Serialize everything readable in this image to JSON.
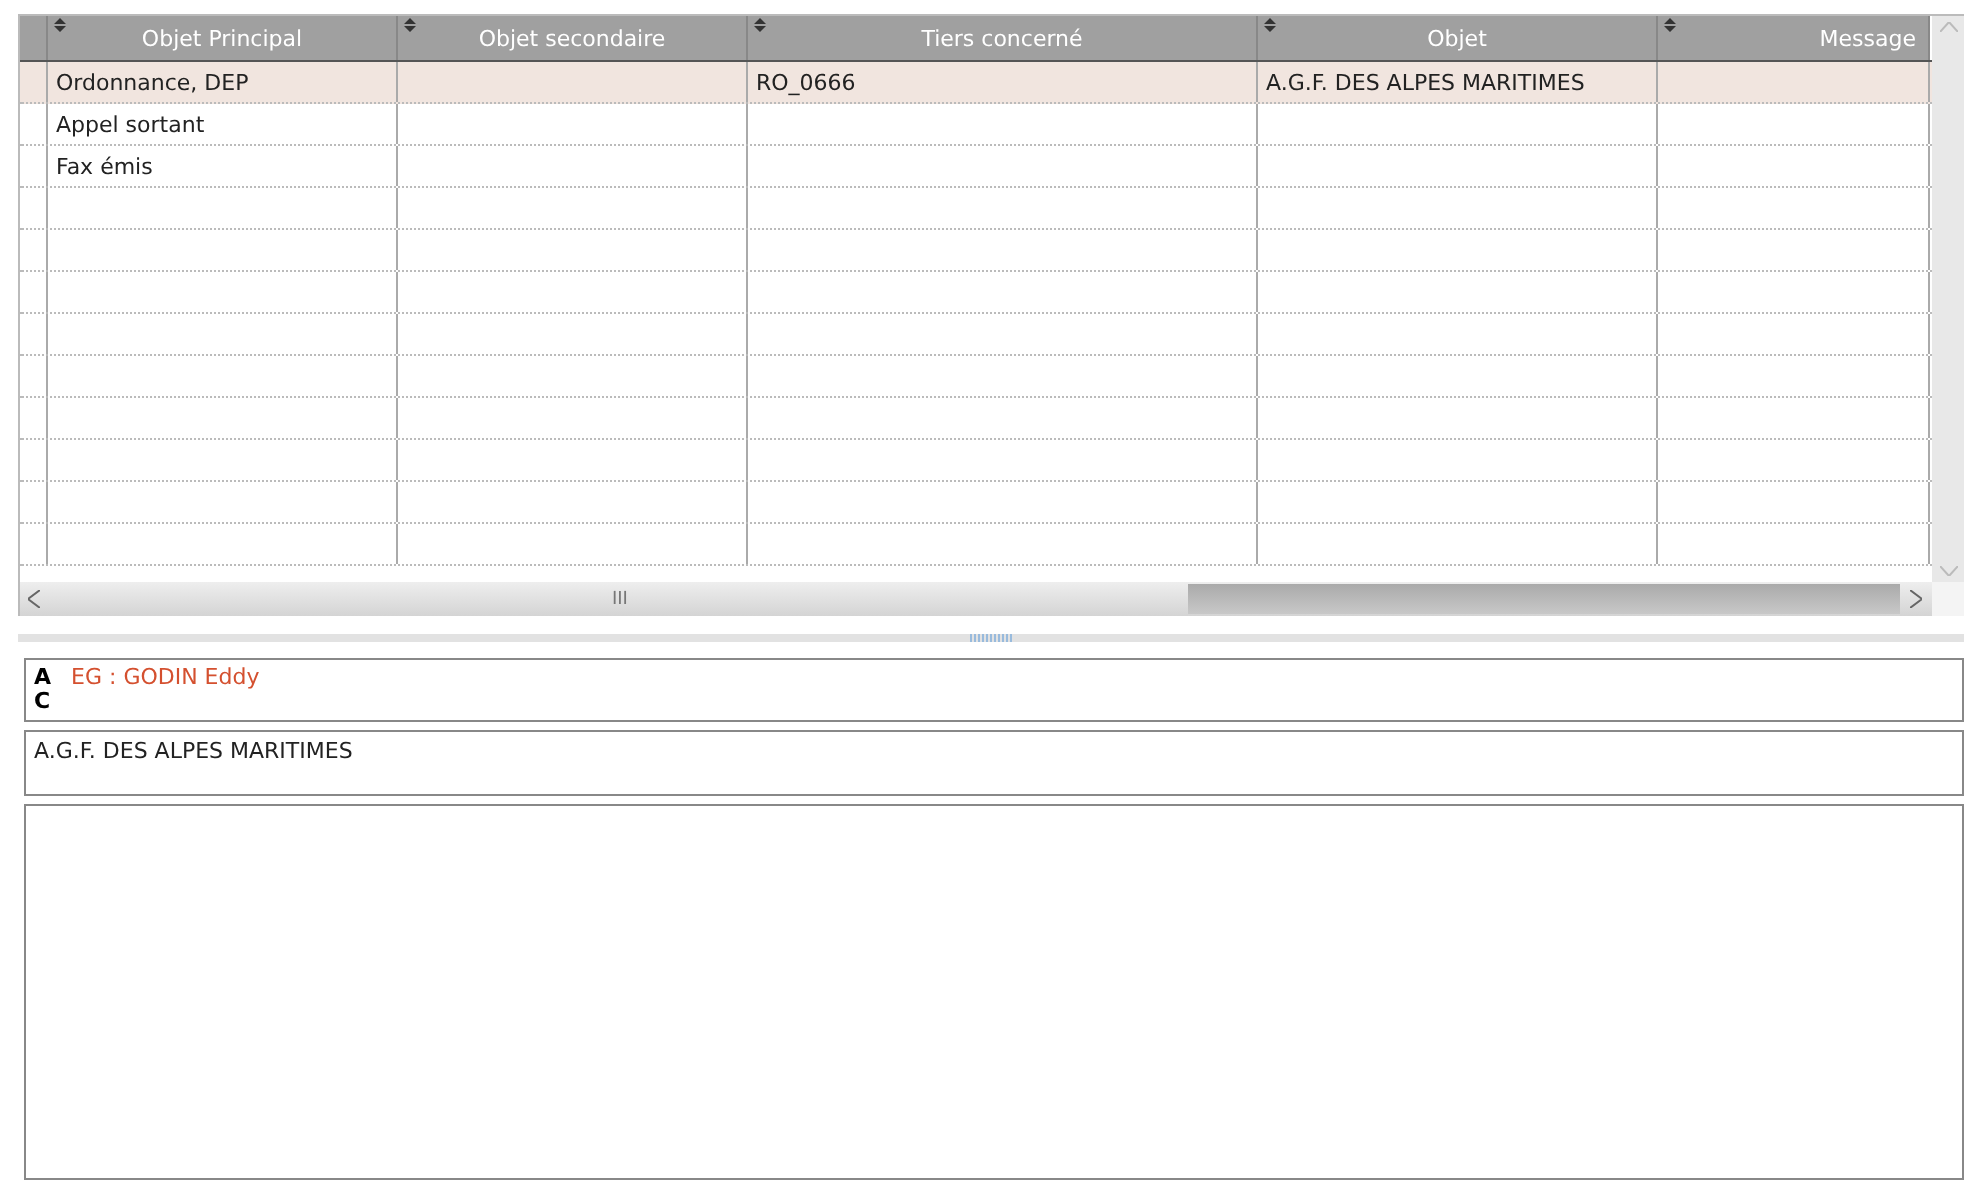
{
  "table": {
    "columns": [
      "Objet Principal",
      "Objet secondaire",
      "Tiers concerné",
      "Objet",
      "Message"
    ],
    "rows": [
      {
        "selected": true,
        "cells": [
          "Ordonnance, DEP",
          "",
          "RO_0666",
          "A.G.F. DES ALPES MARITIMES",
          ""
        ]
      },
      {
        "selected": false,
        "cells": [
          "Appel sortant",
          "",
          "",
          "",
          ""
        ]
      },
      {
        "selected": false,
        "cells": [
          "Fax émis",
          "",
          "",
          "",
          ""
        ]
      }
    ],
    "hscroll_grip": "III"
  },
  "recipients": {
    "labels": [
      "A",
      "C"
    ],
    "value": "EG : GODIN Eddy"
  },
  "subject": {
    "value": "A.G.F. DES ALPES MARITIMES"
  }
}
